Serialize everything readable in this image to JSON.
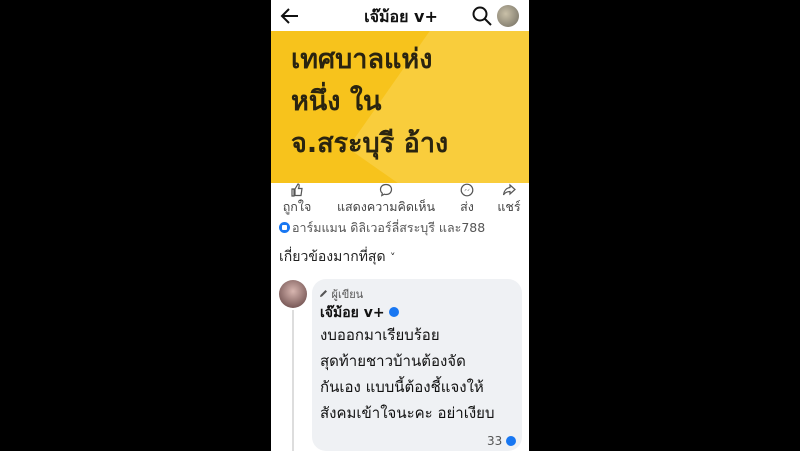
{
  "header": {
    "title": "เจ๊ม้อย v+",
    "back_icon": "arrow-left-icon",
    "search_icon": "search-icon"
  },
  "banner": {
    "background": "#f7c31c",
    "lines": [
      "เทศบาลแห่ง",
      "หนึ่ง ใน",
      "จ.สระบุรี อ้าง"
    ]
  },
  "actions": [
    {
      "label": "ถูกใจ",
      "icon": "thumbs-up-icon"
    },
    {
      "label": "แสดงความคิดเห็น",
      "icon": "comment-icon"
    },
    {
      "label": "ส่ง",
      "icon": "messenger-icon"
    },
    {
      "label": "แชร์",
      "icon": "share-icon"
    }
  ],
  "reactions": {
    "text": "อาร์มแมน ดิลิเวอร์ลี่สระบุรี และ788"
  },
  "sort": {
    "label": "เกี่ยวข้องมากที่สุด",
    "chevron": "˅"
  },
  "comment": {
    "author_tag": "ผู้เขียน",
    "author_name": "เจ๊ม้อย v+",
    "lines": [
      "งบออกมาเรียบร้อย",
      "สุดท้ายชาวบ้านต้องจัด",
      "กันเอง แบบนี้ต้องชี้แจงให้",
      "สังคมเข้าใจนะคะ อย่าเงียบ"
    ],
    "reaction_count": "33"
  },
  "colors": {
    "accent": "#1877f2",
    "banner_text": "#2a2410",
    "bubble": "#eff1f4"
  }
}
